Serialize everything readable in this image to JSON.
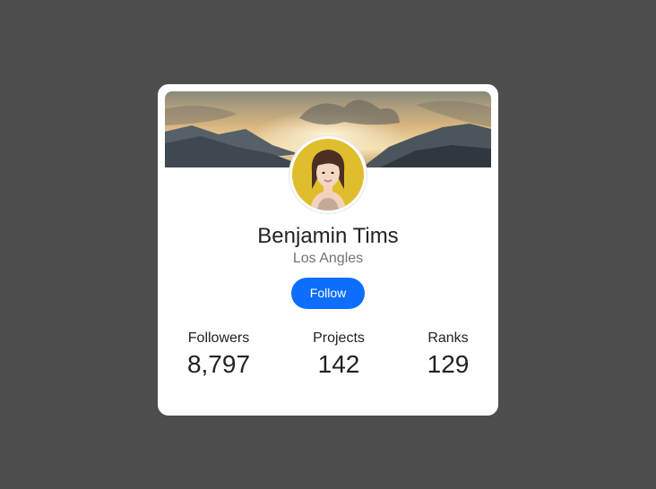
{
  "profile": {
    "name": "Benjamin Tims",
    "location": "Los Angles",
    "follow_label": "Follow"
  },
  "stats": [
    {
      "label": "Followers",
      "value": "8,797"
    },
    {
      "label": "Projects",
      "value": "142"
    },
    {
      "label": "Ranks",
      "value": "129"
    }
  ],
  "colors": {
    "background": "#4d4d4d",
    "card": "#ffffff",
    "accent": "#0d6efd",
    "muted_text": "#6c757d"
  }
}
